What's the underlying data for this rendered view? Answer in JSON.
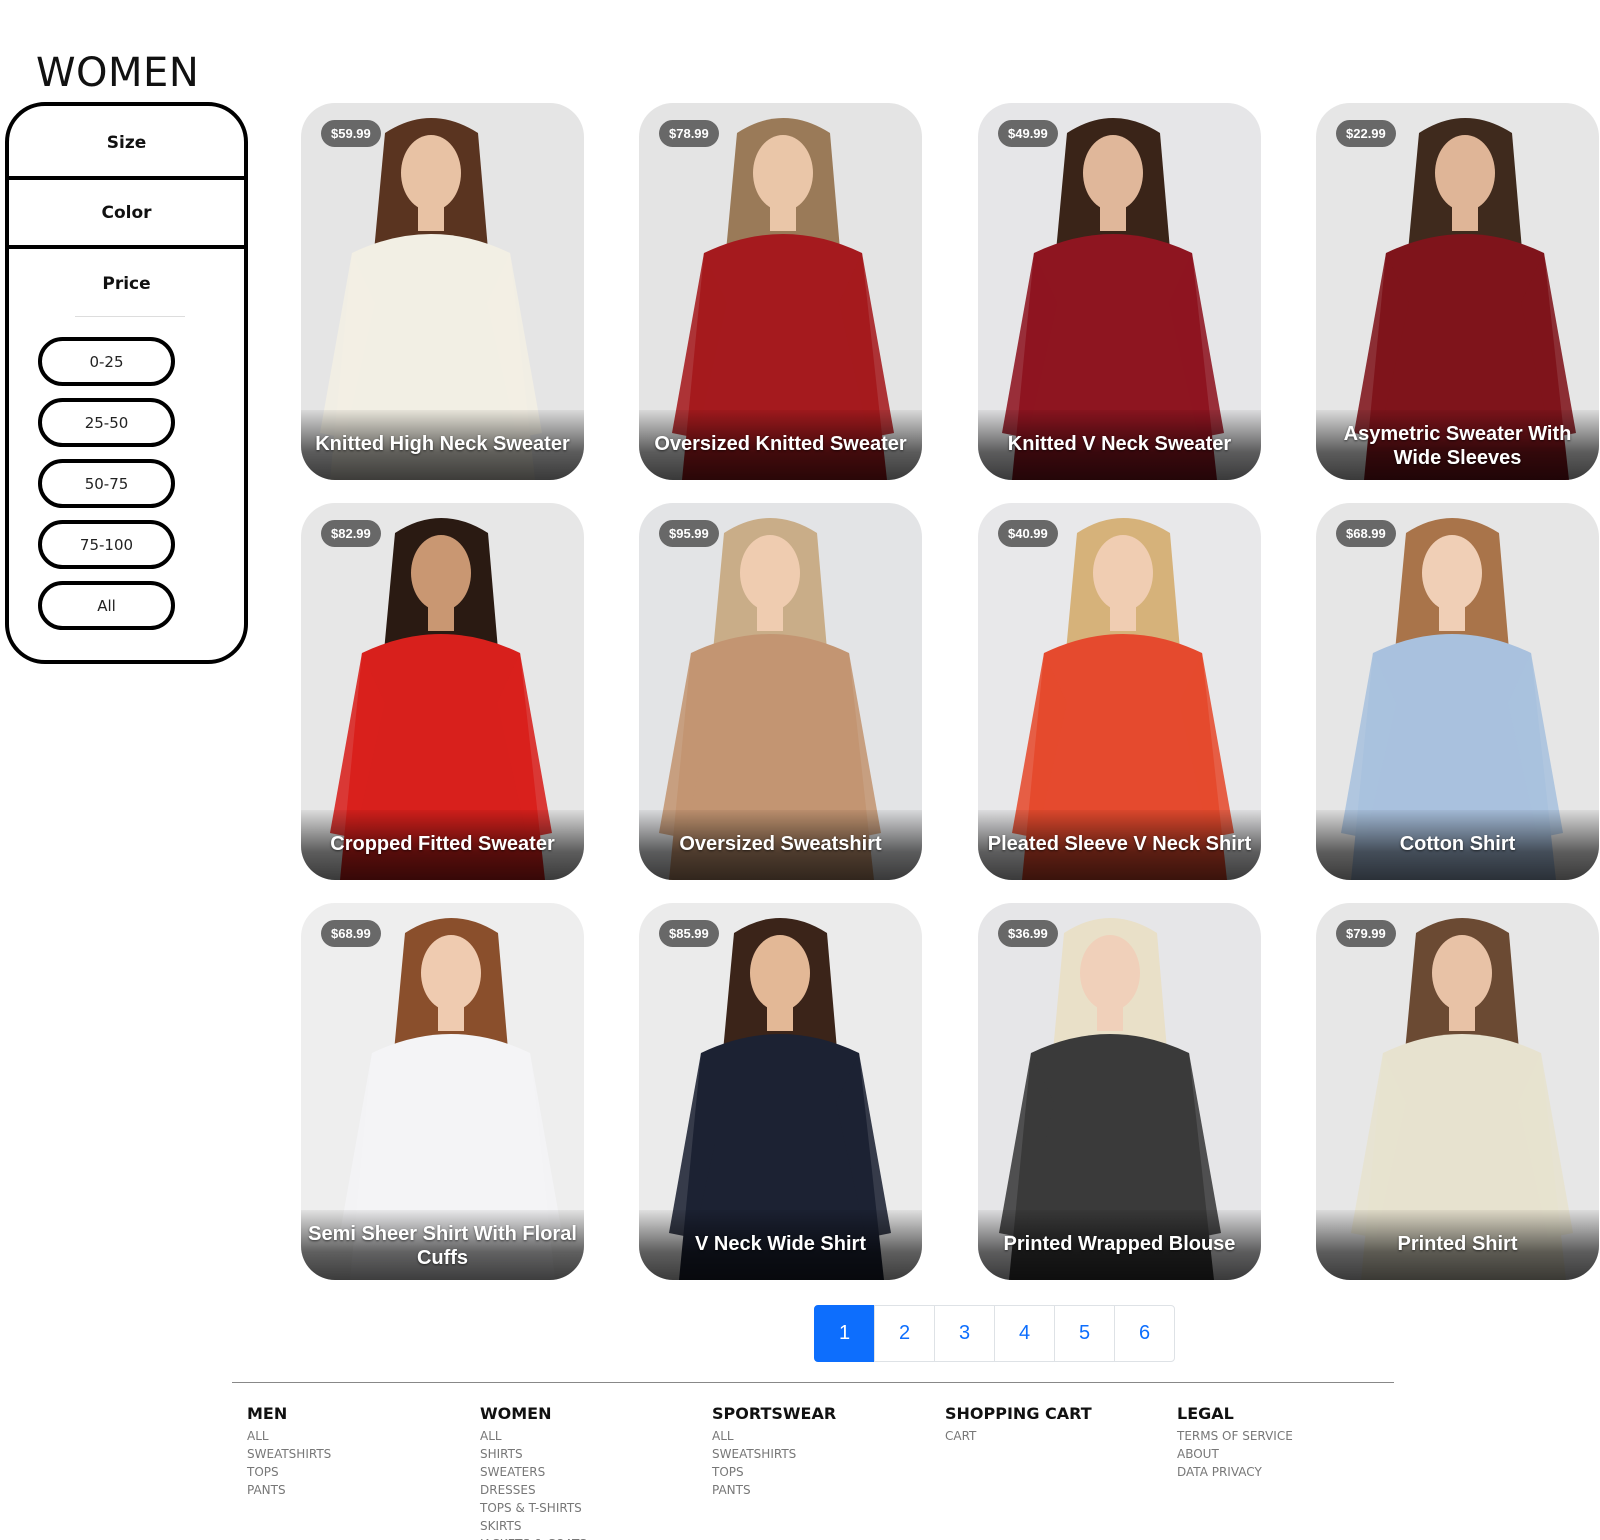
{
  "page": {
    "title": "WOMEN"
  },
  "filters": {
    "size_label": "Size",
    "color_label": "Color",
    "price_label": "Price",
    "price_options": [
      "0-25",
      "25-50",
      "50-75",
      "75-100",
      "All"
    ]
  },
  "products": [
    {
      "name": "Knitted High Neck Sweater",
      "price": "$59.99",
      "garment_color": "#f2efe4",
      "skin": "#e8c2a4",
      "hair": "#5a3420",
      "bg": "#e5e5e5"
    },
    {
      "name": "Oversized Knitted Sweater",
      "price": "$78.99",
      "garment_color": "#a51a1e",
      "skin": "#eac6a8",
      "hair": "#9a7a58",
      "bg": "#e4e4e4"
    },
    {
      "name": "Knitted V Neck Sweater",
      "price": "$49.99",
      "garment_color": "#8e1520",
      "skin": "#e0b79a",
      "hair": "#3a2418",
      "bg": "#e6e6e8"
    },
    {
      "name": "Asymetric Sweater With Wide Sleeves",
      "price": "$22.99",
      "garment_color": "#7f141b",
      "skin": "#dfb597",
      "hair": "#3f2a1d",
      "bg": "#e6e6e6"
    },
    {
      "name": "Cropped Fitted Sweater",
      "price": "$82.99",
      "garment_color": "#d8201c",
      "skin": "#c99772",
      "hair": "#2a1a12",
      "bg": "#e7e7e7"
    },
    {
      "name": "Oversized Sweatshirt",
      "price": "$95.99",
      "garment_color": "#c39572",
      "skin": "#efccb0",
      "hair": "#c9ad88",
      "bg": "#e3e4e6"
    },
    {
      "name": "Pleated Sleeve V Neck Shirt",
      "price": "$40.99",
      "garment_color": "#e54a2e",
      "skin": "#f0cdb2",
      "hair": "#d6b27a",
      "bg": "#e8e8ea"
    },
    {
      "name": "Cotton Shirt",
      "price": "$68.99",
      "garment_color": "#a9c1de",
      "skin": "#f0cfb6",
      "hair": "#a9744a",
      "bg": "#e6e6e6"
    },
    {
      "name": "Semi Sheer Shirt With Floral Cuffs",
      "price": "$68.99",
      "garment_color": "#f4f4f6",
      "skin": "#efcbb0",
      "hair": "#8a4f2c",
      "bg": "#eeeeee"
    },
    {
      "name": "V Neck Wide Shirt",
      "price": "$85.99",
      "garment_color": "#1c2233",
      "skin": "#e3b896",
      "hair": "#3b2419",
      "bg": "#ebebeb"
    },
    {
      "name": "Printed Wrapped Blouse",
      "price": "$36.99",
      "garment_color": "#3a3a3a",
      "skin": "#f0d0ba",
      "hair": "#e9e0c8",
      "bg": "#e6e6e8"
    },
    {
      "name": "Printed Shirt",
      "price": "$79.99",
      "garment_color": "#e7e2cf",
      "skin": "#e8c2a6",
      "hair": "#6b4a33",
      "bg": "#e7e7e7"
    }
  ],
  "pagination": {
    "pages": [
      "1",
      "2",
      "3",
      "4",
      "5",
      "6"
    ],
    "active_page": "1"
  },
  "footer": {
    "columns": [
      {
        "title": "MEN",
        "links": [
          "ALL",
          "SWEATSHIRTS",
          "TOPS",
          "PANTS"
        ]
      },
      {
        "title": "WOMEN",
        "links": [
          "ALL",
          "SHIRTS",
          "SWEATERS",
          "DRESSES",
          "TOPS & T-SHIRTS",
          "SKIRTS",
          "JACKETS & COATS"
        ]
      },
      {
        "title": "SPORTSWEAR",
        "links": [
          "ALL",
          "SWEATSHIRTS",
          "TOPS",
          "PANTS"
        ]
      },
      {
        "title": "SHOPPING CART",
        "links": [
          "CART"
        ]
      },
      {
        "title": "LEGAL",
        "links": [
          "TERMS OF SERVICE",
          "ABOUT",
          "DATA PRIVACY"
        ]
      }
    ]
  },
  "colors": {
    "accent": "#0d6efd",
    "badge": "#5a5a5a",
    "outline": "#000000"
  }
}
